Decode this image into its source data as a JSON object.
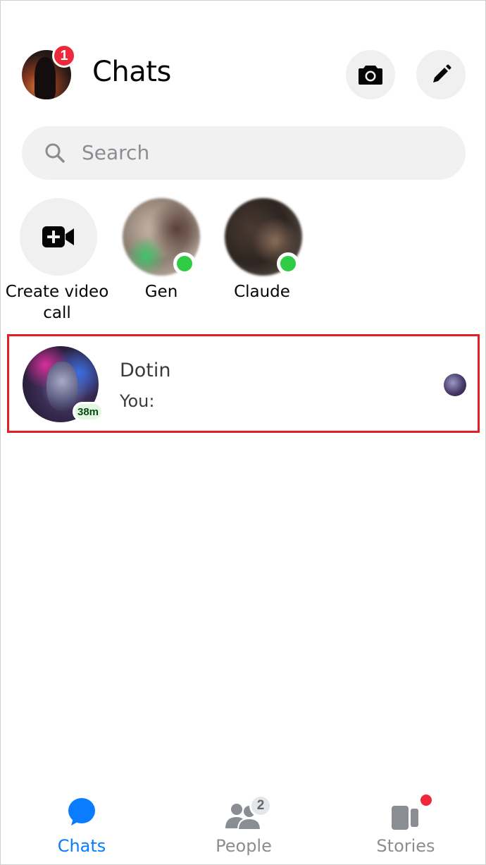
{
  "header": {
    "title": "Chats",
    "profile_badge_count": "1",
    "camera_icon": "camera-icon",
    "compose_icon": "pencil-icon"
  },
  "search": {
    "placeholder": "Search"
  },
  "active_row": {
    "items": [
      {
        "label": "Create video call",
        "icon": "video-plus-icon"
      },
      {
        "label": "Gen",
        "online": true
      },
      {
        "label": "Claude",
        "online": true
      }
    ]
  },
  "chats": [
    {
      "name": "Dotin",
      "preview": "You:",
      "time_badge": "38m",
      "highlighted": true
    }
  ],
  "bottom_nav": {
    "tabs": [
      {
        "label": "Chats",
        "icon": "chat-bubble-icon",
        "active": true
      },
      {
        "label": "People",
        "icon": "people-icon",
        "badge": "2"
      },
      {
        "label": "Stories",
        "icon": "stories-icon",
        "has_dot": true
      }
    ]
  },
  "colors": {
    "accent_blue": "#0a7cff",
    "inactive_gray": "#8a8d91",
    "online_green": "#31cc46",
    "badge_red": "#f0283c",
    "highlight_red": "#e31e24"
  }
}
